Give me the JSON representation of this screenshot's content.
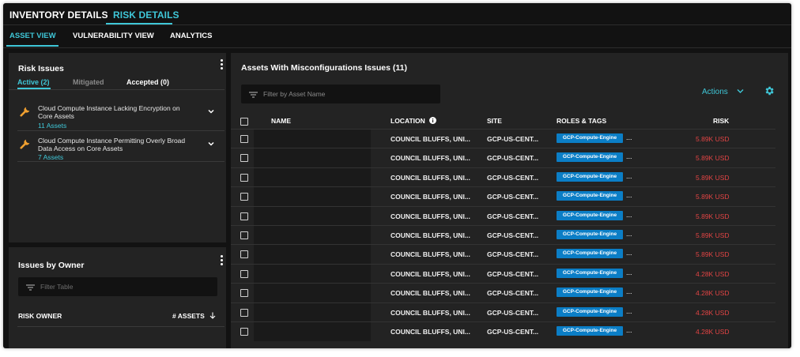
{
  "top_tabs": [
    {
      "label": "INVENTORY DETAILS",
      "active": false
    },
    {
      "label": "RISK DETAILS",
      "active": true
    }
  ],
  "sub_tabs": [
    {
      "label": "ASSET VIEW",
      "active": true
    },
    {
      "label": "VULNERABILITY VIEW",
      "active": false
    },
    {
      "label": "ANALYTICS",
      "active": false
    }
  ],
  "risk_issues": {
    "title": "Risk Issues",
    "tabs": [
      "Active (2)",
      "Mitigated",
      "Accepted (0)"
    ],
    "items": [
      {
        "line1": "Cloud Compute Instance Lacking Encryption on",
        "line2": "Core Assets",
        "count": "11 Assets"
      },
      {
        "line1": "Cloud Compute Instance Permitting Overly Broad",
        "line2": "Data Access on Core Assets",
        "count": "7 Assets"
      }
    ]
  },
  "issues_by_owner": {
    "title": "Issues by Owner",
    "filter_placeholder": "Filter Table",
    "col_owner": "RISK OWNER",
    "col_assets": "# ASSETS"
  },
  "assets_table": {
    "title": "Assets With Misconfigurations Issues (11)",
    "filter_placeholder": "Filter by Asset Name",
    "actions_label": "Actions",
    "columns": {
      "name": "NAME",
      "location": "LOCATION",
      "site": "SITE",
      "roles": "ROLES & TAGS",
      "risk": "RISK"
    },
    "rows": [
      {
        "location": "COUNCIL BLUFFS, UNI...",
        "site": "GCP-US-CENT...",
        "tag": "GCP-Compute-Engine",
        "more": "...",
        "risk": "5.89K USD"
      },
      {
        "location": "COUNCIL BLUFFS, UNI...",
        "site": "GCP-US-CENT...",
        "tag": "GCP-Compute-Engine",
        "more": "...",
        "risk": "5.89K USD"
      },
      {
        "location": "COUNCIL BLUFFS, UNI...",
        "site": "GCP-US-CENT...",
        "tag": "GCP-Compute-Engine",
        "more": "...",
        "risk": "5.89K USD"
      },
      {
        "location": "COUNCIL BLUFFS, UNI...",
        "site": "GCP-US-CENT...",
        "tag": "GCP-Compute-Engine",
        "more": "...",
        "risk": "5.89K USD"
      },
      {
        "location": "COUNCIL BLUFFS, UNI...",
        "site": "GCP-US-CENT...",
        "tag": "GCP-Compute-Engine",
        "more": "...",
        "risk": "5.89K USD"
      },
      {
        "location": "COUNCIL BLUFFS, UNI...",
        "site": "GCP-US-CENT...",
        "tag": "GCP-Compute-Engine",
        "more": "...",
        "risk": "5.89K USD"
      },
      {
        "location": "COUNCIL BLUFFS, UNI...",
        "site": "GCP-US-CENT...",
        "tag": "GCP-Compute-Engine",
        "more": "...",
        "risk": "5.89K USD"
      },
      {
        "location": "COUNCIL BLUFFS, UNI...",
        "site": "GCP-US-CENT...",
        "tag": "GCP-Compute-Engine",
        "more": "...",
        "risk": "4.28K USD"
      },
      {
        "location": "COUNCIL BLUFFS, UNI...",
        "site": "GCP-US-CENT...",
        "tag": "GCP-Compute-Engine",
        "more": "...",
        "risk": "4.28K USD"
      },
      {
        "location": "COUNCIL BLUFFS, UNI...",
        "site": "GCP-US-CENT...",
        "tag": "GCP-Compute-Engine",
        "more": "...",
        "risk": "4.28K USD"
      },
      {
        "location": "COUNCIL BLUFFS, UNI...",
        "site": "GCP-US-CENT...",
        "tag": "GCP-Compute-Engine",
        "more": "...",
        "risk": "4.28K USD"
      }
    ]
  },
  "icons": {
    "issue": "wrench-icon",
    "expand": "chevron-down-icon",
    "filter": "filter-lines-icon",
    "info": "info-icon",
    "sort": "arrow-down-icon",
    "settings": "gear-icon",
    "menu": "kebab-menu-icon"
  },
  "colors": {
    "accent": "#3fc7d8",
    "background": "#121212",
    "panel": "#232323",
    "tag": "#0b7ec6",
    "risk": "#e24444",
    "wrench": "#f0a030"
  }
}
